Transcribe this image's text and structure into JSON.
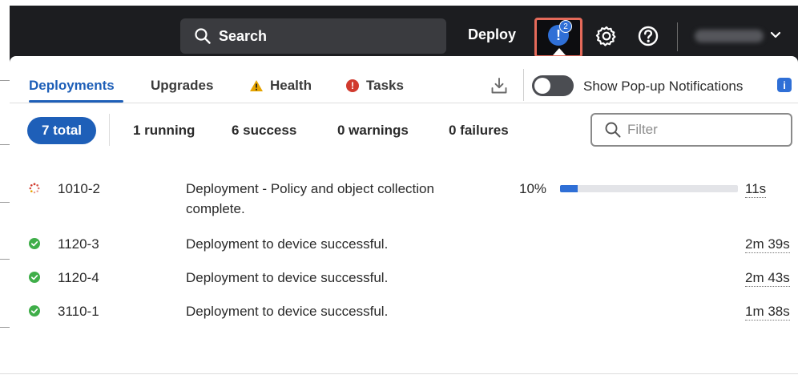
{
  "header": {
    "search_label": "Search",
    "deploy_label": "Deploy",
    "notification_count": "2",
    "notification_glyph": "!"
  },
  "tabs": [
    {
      "label": "Deployments"
    },
    {
      "label": "Upgrades"
    },
    {
      "label": "Health"
    },
    {
      "label": "Tasks"
    }
  ],
  "popup_toggle": {
    "label": "Show Pop-up Notifications",
    "on": false,
    "info_glyph": "i"
  },
  "filters": {
    "total": "7 total",
    "running": "1 running",
    "success": "6 success",
    "warnings": "0 warnings",
    "failures": "0 failures",
    "filter_placeholder": "Filter"
  },
  "deployments": [
    {
      "status": "running",
      "id": "1010-2",
      "description": "Deployment - Policy and object collection complete.",
      "progress_text": "10%",
      "progress": 0.1,
      "duration": "11s"
    },
    {
      "status": "success",
      "id": "1120-3",
      "description": "Deployment to device successful.",
      "duration": "2m 39s"
    },
    {
      "status": "success",
      "id": "1120-4",
      "description": "Deployment to device successful.",
      "duration": "2m 43s"
    },
    {
      "status": "success",
      "id": "3110-1",
      "description": "Deployment to device successful.",
      "duration": "1m 38s"
    }
  ],
  "colors": {
    "accent": "#1e5fb8",
    "success": "#3fae49",
    "error": "#d13a2e",
    "warning": "#e6a400",
    "highlight": "#e56a5a",
    "header_bg": "#1c1d20"
  }
}
